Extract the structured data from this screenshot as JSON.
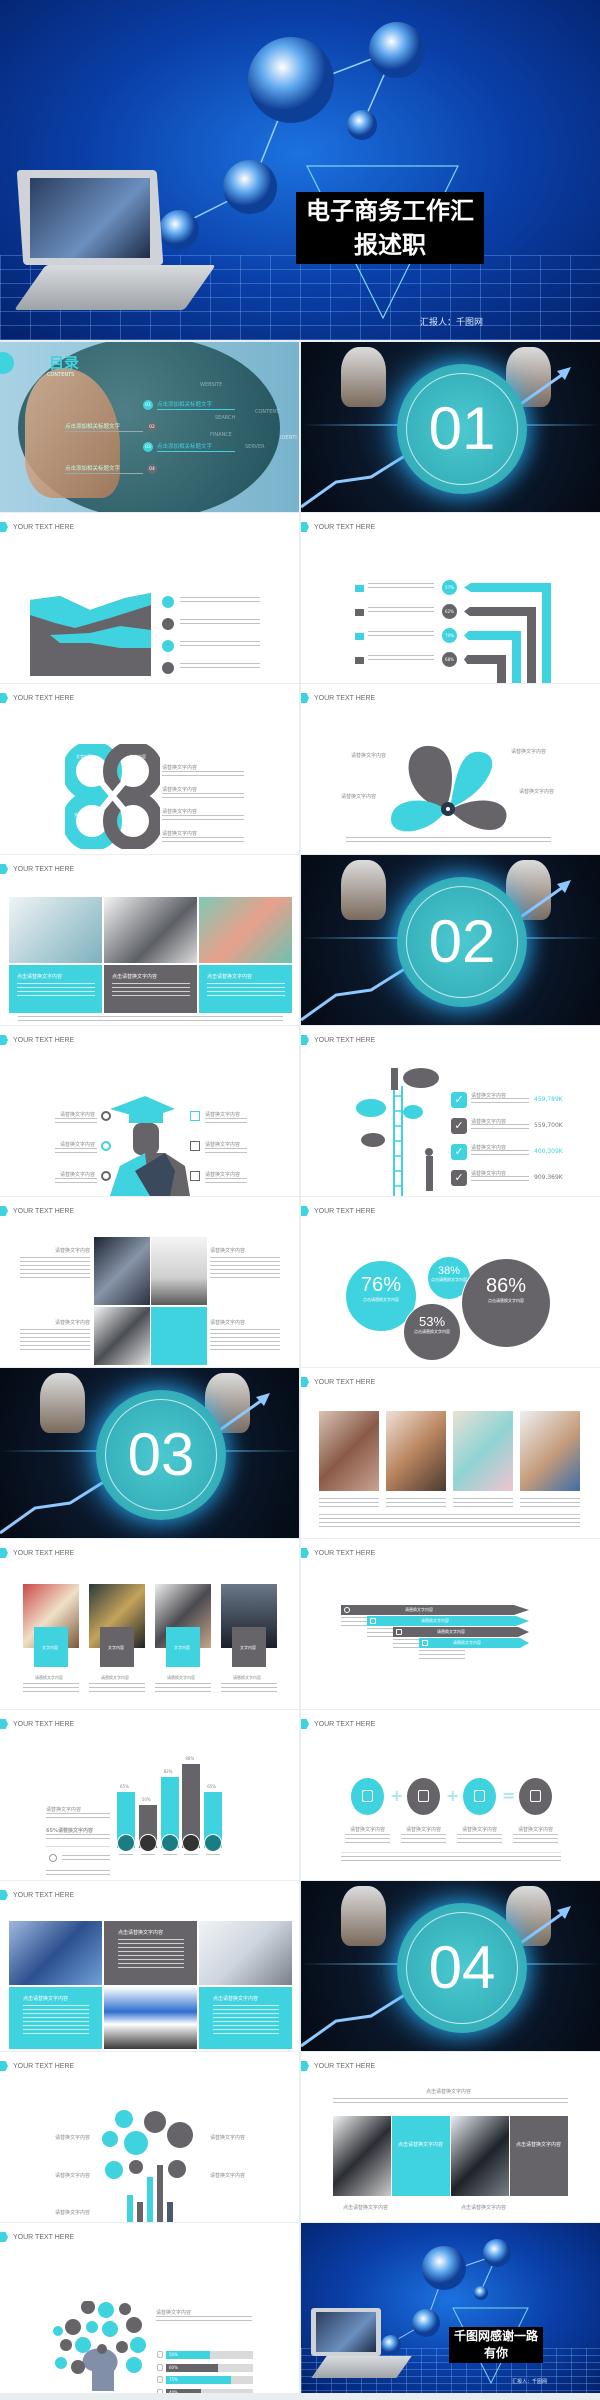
{
  "colors": {
    "accent": "#3fd3df",
    "grey": "#666468",
    "cover_blue": "#0a3fa8"
  },
  "cover": {
    "title_line1": "电子商务工作汇",
    "title_line2": "报述职",
    "reporter": "汇报人：千图网"
  },
  "slide_header": "YOUR TEXT HERE",
  "toc": {
    "title": "目录",
    "subtitle": "CONTENTS",
    "items": [
      {
        "num": "01",
        "label": "点击添加相关标题文字"
      },
      {
        "num": "02",
        "label": "点击添加相关标题文字"
      },
      {
        "num": "03",
        "label": "点击添加相关标题文字"
      },
      {
        "num": "04",
        "label": "点击添加相关标题文字"
      }
    ],
    "bg_words": [
      "WEBSITE",
      "CONTENT",
      "SEARCH",
      "FINANCE",
      "SERVER",
      "IDENTI"
    ]
  },
  "sections": [
    "01",
    "02",
    "03",
    "04"
  ],
  "placeholder_title": "请替换文字内容",
  "placeholder_title2": "点击请替换文字内容",
  "knot_labels": [
    "文字内容",
    "文字内容",
    "文字内容",
    "文字内容"
  ],
  "arrow_list": {
    "percents": [
      "57%",
      "62%",
      "70%",
      "68%"
    ]
  },
  "photo_cards": {
    "box_label": "文字内容"
  },
  "checklist": {
    "values": [
      "459,789K",
      "559,700K",
      "400,309K",
      "909,369K"
    ]
  },
  "circles": [
    {
      "value": "76%",
      "color": "teal"
    },
    {
      "value": "38%",
      "color": "teal"
    },
    {
      "value": "53%",
      "color": "grey"
    },
    {
      "value": "86%",
      "color": "grey"
    }
  ],
  "chart_data": {
    "type": "bar",
    "categories": [
      "",
      "",
      "",
      "",
      ""
    ],
    "values": [
      65,
      50,
      82,
      98,
      65
    ],
    "value_labels": [
      "65%",
      "50%",
      "82%",
      "98%",
      "65%"
    ],
    "colors": [
      "#3fd3df",
      "#666468",
      "#3fd3df",
      "#666468",
      "#3fd3df"
    ],
    "ylim": [
      0,
      100
    ]
  },
  "bar_side": {
    "heading": "请替换文字内容",
    "heading2": "65%请替换文字内容"
  },
  "progress": {
    "items": [
      {
        "label": "50%",
        "value": 50
      },
      {
        "label": "60%",
        "value": 60
      },
      {
        "label": "75%",
        "value": 75
      },
      {
        "label": "40%",
        "value": 40
      }
    ]
  },
  "end": {
    "title_line1": "千图网感谢一路",
    "title_line2": "有你",
    "reporter": "汇报人：千图网"
  }
}
